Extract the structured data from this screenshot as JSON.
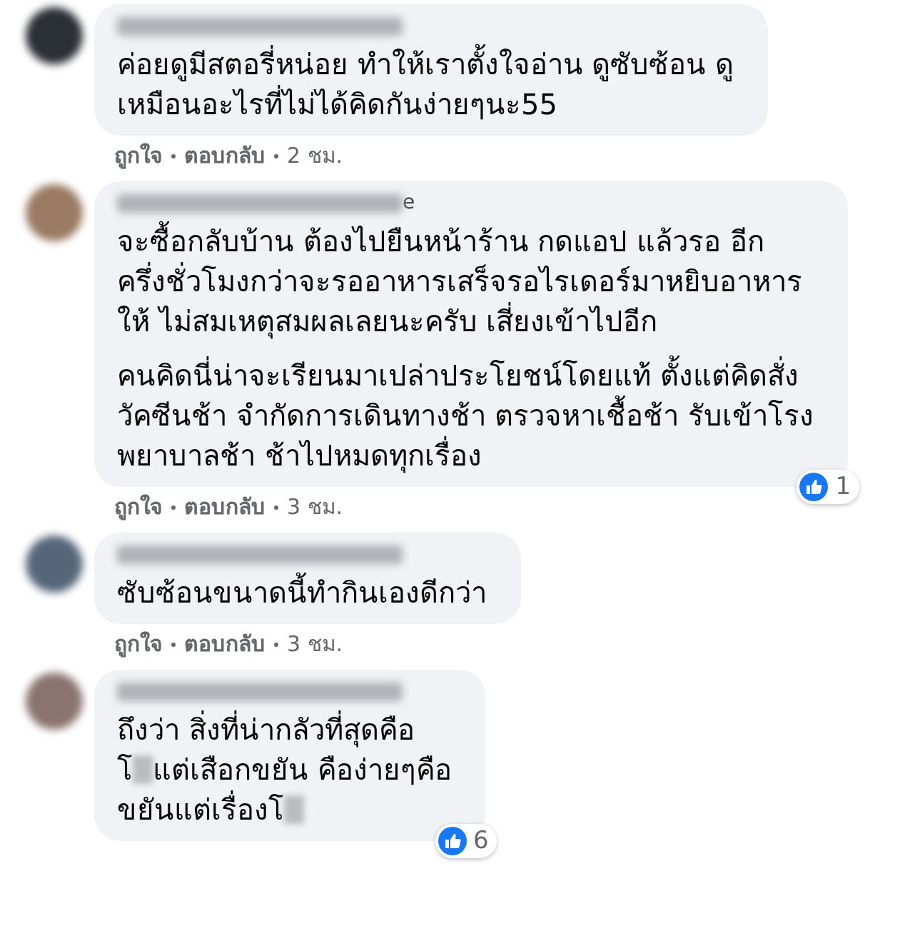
{
  "comments": [
    {
      "paragraphs": [
        [
          [
            {
              "kind": "text",
              "text": "ค่อยดูมีสตอรี่หน่อย ทำให้เราตั้งใจอ่าน ดูซับซ้อน ดู"
            }
          ],
          [
            {
              "kind": "text",
              "text": "เหมือนอะไรที่ไม่ได้คิดกันง่ายๆนะ55"
            }
          ]
        ]
      ],
      "actions": {
        "like": "ถูกใจ",
        "reply": "ตอบกลับ",
        "time": "2 ชม."
      }
    },
    {
      "name_tail": "e",
      "paragraphs": [
        [
          [
            {
              "kind": "text",
              "text": "จะซื้อกลับบ้าน ต้องไปยืนหน้าร้าน กดแอป แล้วรอ อีก"
            }
          ],
          [
            {
              "kind": "text",
              "text": "ครึ่งชั่วโมงกว่าจะรออาหารเสร็จรอไรเดอร์มาหยิบอาหาร"
            }
          ],
          [
            {
              "kind": "text",
              "text": "ให้ ไม่สมเหตุสมผลเลยนะครับ เสี่ยงเข้าไปอีก"
            }
          ]
        ],
        [
          [
            {
              "kind": "text",
              "text": "คนคิดนี่น่าจะเรียนมาเปล่าประโยชน์โดยแท้ ตั้งแต่คิดสั่ง"
            }
          ],
          [
            {
              "kind": "text",
              "text": "วัคซีนช้า จำกัดการเดินทางช้า ตรวจหาเชื้อช้า รับเข้าโรง"
            }
          ],
          [
            {
              "kind": "text",
              "text": "พยาบาลช้า ช้าไปหมดทุกเรื่อง"
            }
          ]
        ]
      ],
      "reactions": "1",
      "actions": {
        "like": "ถูกใจ",
        "reply": "ตอบกลับ",
        "time": "3 ชม."
      }
    },
    {
      "paragraphs": [
        [
          [
            {
              "kind": "text",
              "text": "ซับซ้อนขนาดนี้ทำกินเองดีกว่า"
            }
          ]
        ]
      ],
      "actions": {
        "like": "ถูกใจ",
        "reply": "ตอบกลับ",
        "time": "3 ชม."
      }
    },
    {
      "paragraphs": [
        [
          [
            {
              "kind": "text",
              "text": "ถึงว่า สิ่งที่น่ากลัวที่สุดคือ"
            }
          ],
          [
            {
              "kind": "text",
              "text": "โ"
            },
            {
              "kind": "censor"
            },
            {
              "kind": "text",
              "text": "แต่เสือกขยัน คือง่ายๆคือ"
            }
          ],
          [
            {
              "kind": "text",
              "text": "ขยันแต่เรื่องโ"
            },
            {
              "kind": "censor"
            }
          ]
        ]
      ],
      "reactions": "6"
    }
  ]
}
